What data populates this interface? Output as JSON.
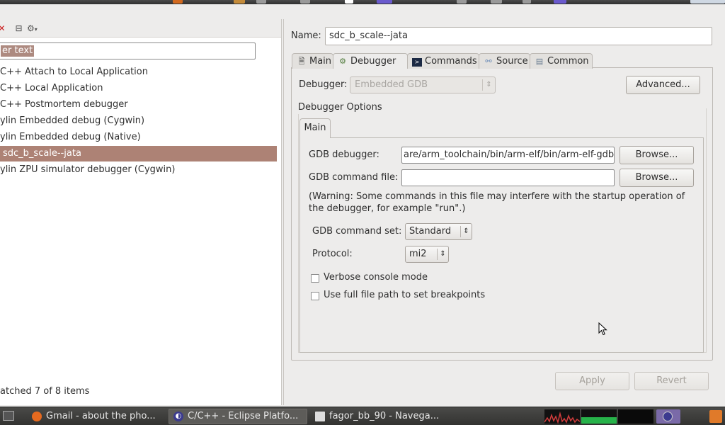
{
  "left": {
    "filter_placeholder_visible": "er text",
    "items": [
      "C++ Attach to Local Application",
      "C++ Local Application",
      "C++ Postmortem debugger",
      "ylin Embedded debug (Cygwin)",
      "ylin Embedded debug (Native)",
      "sdc_b_scale--jata",
      "ylin ZPU simulator debugger (Cygwin)"
    ],
    "selected_index": 5,
    "status": "atched 7 of 8 items"
  },
  "right": {
    "name_label": "Name:",
    "name_value": "sdc_b_scale--jata",
    "tabs": [
      {
        "label": "Main",
        "icon": "main-tab-icon"
      },
      {
        "label": "Debugger",
        "icon": "bug-gear-icon"
      },
      {
        "label": "Commands",
        "icon": "terminal-icon"
      },
      {
        "label": "Source",
        "icon": "source-icon"
      },
      {
        "label": "Common",
        "icon": "common-icon"
      }
    ],
    "active_tab": "Debugger",
    "debugger_label": "Debugger:",
    "debugger_value": "Embedded GDB",
    "advanced_button": "Advanced...",
    "options_label": "Debugger Options",
    "inner_tab": "Main",
    "gdb_debugger_label": "GDB debugger:",
    "gdb_debugger_value": "are/arm_toolchain/bin/arm-elf/bin/arm-elf-gdb",
    "browse_label": "Browse...",
    "gdb_command_file_label": "GDB command file:",
    "gdb_command_file_value": "",
    "warning_line1": "(Warning: Some commands in this file may interfere with the startup operation of",
    "warning_line2": "the debugger, for example \"run\".)",
    "command_set_label": "GDB command set:",
    "command_set_value": "Standard",
    "protocol_label": "Protocol:",
    "protocol_value": "mi2",
    "verbose_label": "Verbose console mode",
    "verbose_checked": false,
    "fullpath_label": "Use full file path to set breakpoints",
    "fullpath_checked": false,
    "apply_button": "Apply",
    "revert_button": "Revert"
  },
  "taskbar": {
    "items": [
      {
        "label": "Gmail - about the pho...",
        "icon": "firefox-icon"
      },
      {
        "label": "C/C++ - Eclipse Platfo...",
        "icon": "eclipse-icon"
      },
      {
        "label": "fagor_bb_90 - Navega...",
        "icon": "file-manager-icon"
      }
    ],
    "active_index": 1
  },
  "colors": {
    "selection": "#ad8275",
    "window_bg": "#edeceb",
    "taskbar_bg": "#3c3c3a"
  }
}
